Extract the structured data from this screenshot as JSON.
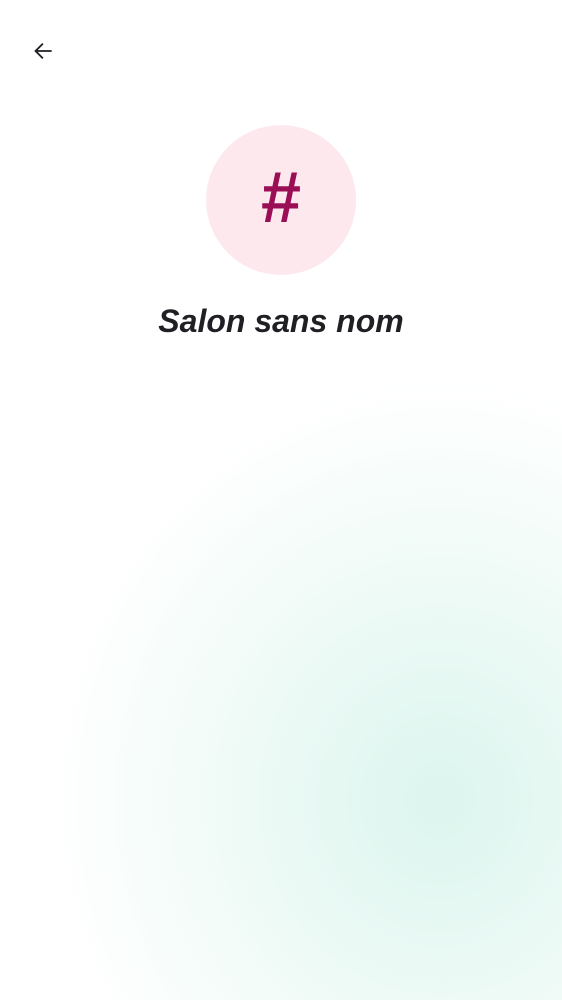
{
  "header": {
    "back_icon": "arrow-left-icon"
  },
  "room": {
    "avatar_glyph": "#",
    "name": "Salon sans nom"
  },
  "colors": {
    "avatar_background": "#fde8ee",
    "avatar_glyph": "#9a0e56",
    "title_text": "#1f1f24",
    "icon": "#1f1f24",
    "gradient_accent": "#e2f6ef"
  }
}
